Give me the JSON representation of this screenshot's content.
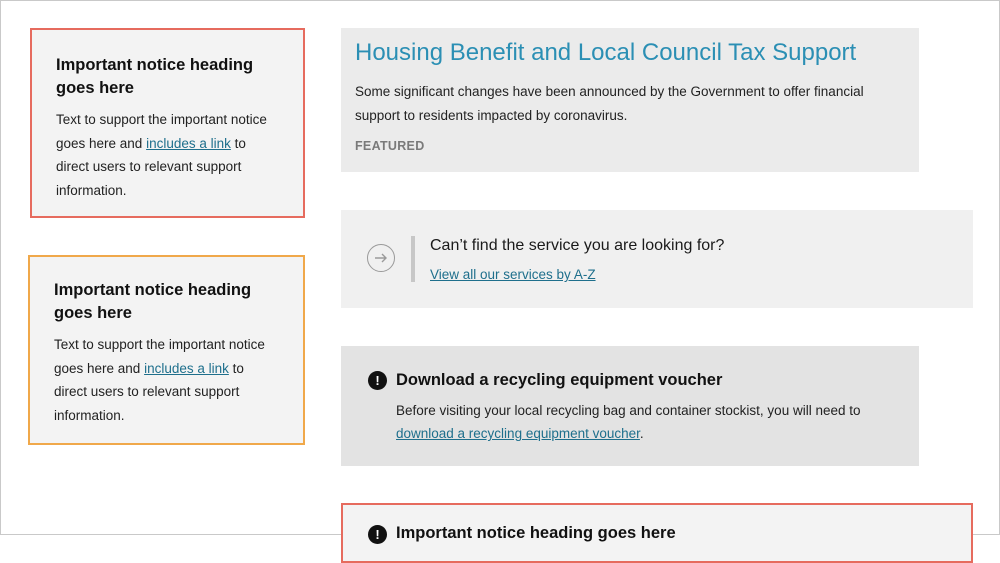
{
  "notices": [
    {
      "heading": "Important notice heading goes here",
      "text_before": "Text to support the important notice goes here and ",
      "link": "includes a link",
      "text_after": " to direct users to relevant support information."
    },
    {
      "heading": "Important notice heading goes here",
      "text_before": "Text to support the important notice goes here and ",
      "link": "includes a link",
      "text_after": " to direct users to relevant support information."
    }
  ],
  "featured": {
    "title": "Housing Benefit and Local Council Tax Support",
    "description": "Some significant changes have been announced by the Government to offer financial support to residents impacted by coronavirus.",
    "tag": "FEATURED"
  },
  "cant_find": {
    "icon": "arrow-right-circle-icon",
    "question": "Can’t find the service you are looking for?",
    "link": "View all our services by A-Z"
  },
  "voucher": {
    "icon": "exclamation-icon",
    "icon_glyph": "!",
    "title": "Download a recycling equipment voucher",
    "text_before": "Before visiting your local recycling bag and container stockist, you will need to ",
    "link": "download a recycling equipment voucher",
    "text_after": "."
  },
  "bottom_notice": {
    "icon": "exclamation-icon",
    "icon_glyph": "!",
    "heading": "Important notice heading goes here"
  },
  "colors": {
    "link": "#1e6f8c",
    "title_accent": "#2b8fb4",
    "notice_red": "#e66b5e",
    "notice_orange": "#f0a84a"
  }
}
